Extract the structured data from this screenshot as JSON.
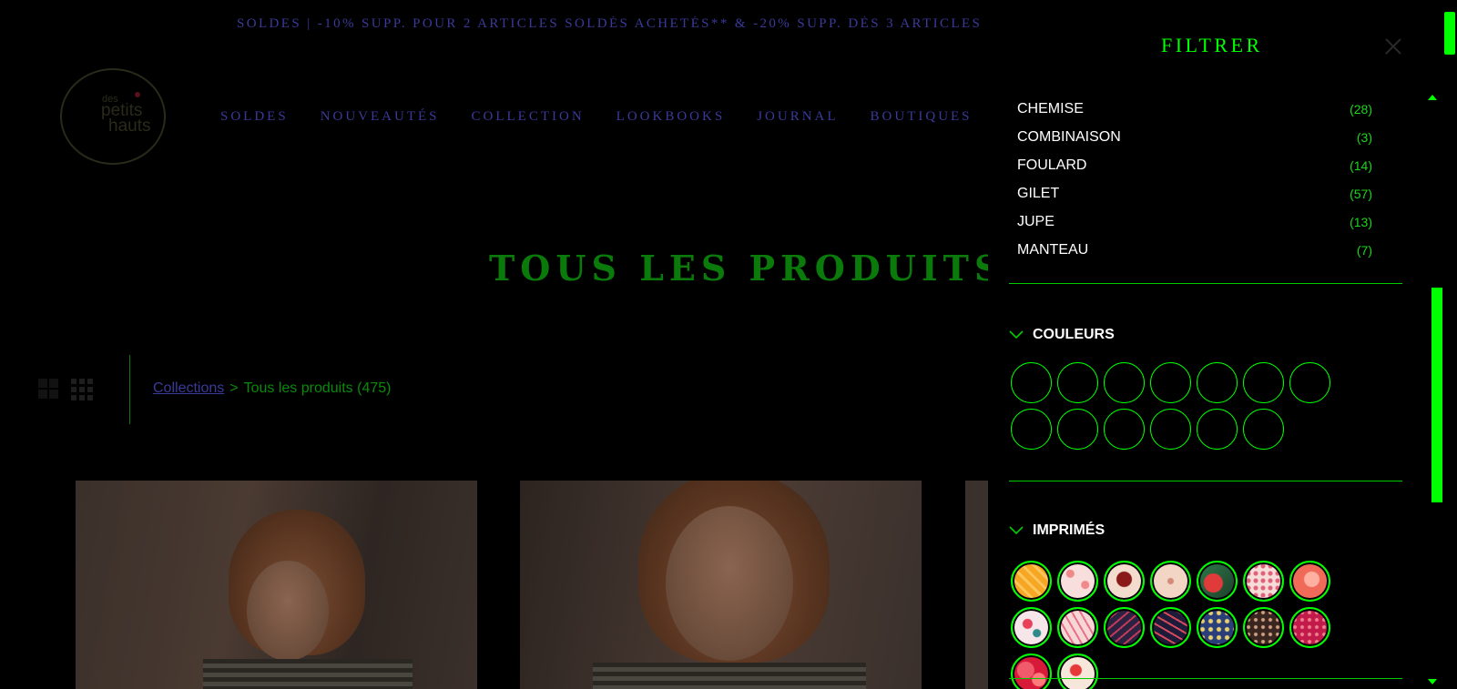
{
  "promo": {
    "text": "SOLDES | -10% SUPP. POUR 2 ARTICLES SOLDÉS ACHETÉS** & -20% SUPP. DÈS 3 ARTICLES"
  },
  "logo": {
    "line1": "des",
    "line2": "petits",
    "line3": "hauts"
  },
  "nav": [
    "SOLDES",
    "NOUVEAUTÉS",
    "COLLECTION",
    "LOOKBOOKS",
    "JOURNAL",
    "BOUTIQUES"
  ],
  "page_title": "TOUS LES PRODUITS",
  "breadcrumb": {
    "link": "Collections",
    "separator": ">",
    "current": "Tous les produits (475)"
  },
  "drawer": {
    "title": "FILTRER",
    "types": [
      {
        "label": "CHEMISE",
        "count": "(28)"
      },
      {
        "label": "COMBINAISON",
        "count": "(3)"
      },
      {
        "label": "FOULARD",
        "count": "(14)"
      },
      {
        "label": "GILET",
        "count": "(57)"
      },
      {
        "label": "JUPE",
        "count": "(13)"
      },
      {
        "label": "MANTEAU",
        "count": "(7)"
      }
    ],
    "colors_title": "COULEURS",
    "prints_title": "IMPRIMÉS"
  },
  "colors": {
    "accent": "#00ff00",
    "nav_text": "#3a3a9a",
    "title": "#0a7a0a"
  }
}
